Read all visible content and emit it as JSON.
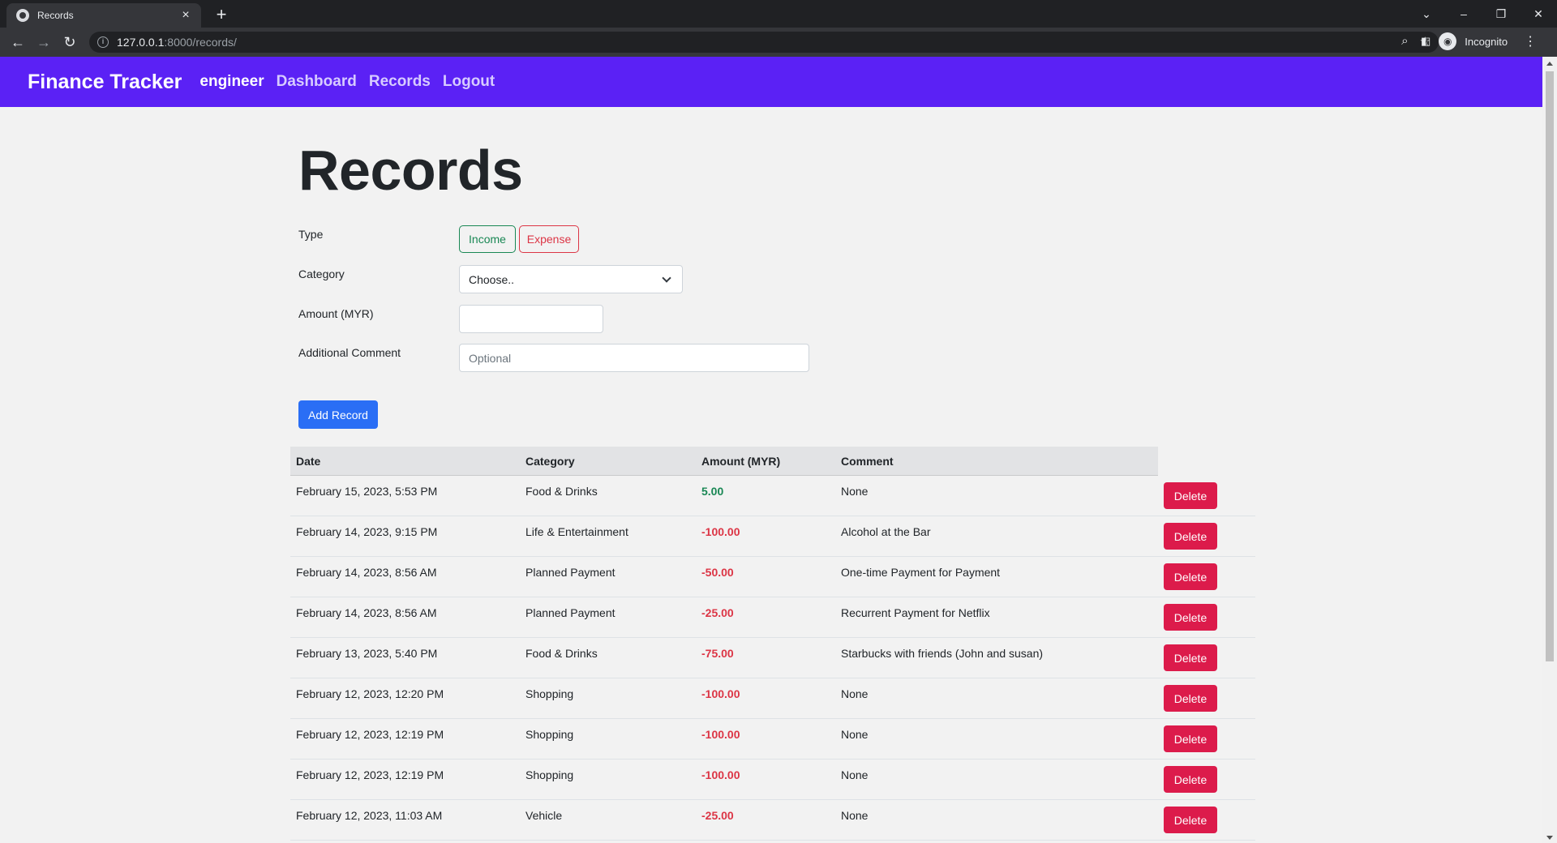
{
  "browser": {
    "tab_title": "Records",
    "url_host": "127.0.0.1",
    "url_rest": ":8000/records/",
    "profile_label": "Incognito"
  },
  "navbar": {
    "brand": "Finance Tracker",
    "user": "engineer",
    "links": [
      "Dashboard",
      "Records",
      "Logout"
    ],
    "bg_color": "#5b21f5"
  },
  "page": {
    "title": "Records"
  },
  "form": {
    "type_label": "Type",
    "income_label": "Income",
    "expense_label": "Expense",
    "category_label": "Category",
    "category_value": "Choose..",
    "amount_label": "Amount (MYR)",
    "amount_value": "",
    "comment_label": "Additional Comment",
    "comment_placeholder": "Optional",
    "submit_label": "Add Record"
  },
  "table": {
    "headers": [
      "Date",
      "Category",
      "Amount (MYR)",
      "Comment"
    ],
    "delete_label": "Delete",
    "rows": [
      {
        "date": "February 15, 2023, 5:53 PM",
        "category": "Food & Drinks",
        "amount": "5.00",
        "type": "income",
        "comment": "None"
      },
      {
        "date": "February 14, 2023, 9:15 PM",
        "category": "Life & Entertainment",
        "amount": "-100.00",
        "type": "expense",
        "comment": "Alcohol at the Bar"
      },
      {
        "date": "February 14, 2023, 8:56 AM",
        "category": "Planned Payment",
        "amount": "-50.00",
        "type": "expense",
        "comment": "One-time Payment for Payment"
      },
      {
        "date": "February 14, 2023, 8:56 AM",
        "category": "Planned Payment",
        "amount": "-25.00",
        "type": "expense",
        "comment": "Recurrent Payment for Netflix"
      },
      {
        "date": "February 13, 2023, 5:40 PM",
        "category": "Food & Drinks",
        "amount": "-75.00",
        "type": "expense",
        "comment": "Starbucks with friends (John and susan)"
      },
      {
        "date": "February 12, 2023, 12:20 PM",
        "category": "Shopping",
        "amount": "-100.00",
        "type": "expense",
        "comment": "None"
      },
      {
        "date": "February 12, 2023, 12:19 PM",
        "category": "Shopping",
        "amount": "-100.00",
        "type": "expense",
        "comment": "None"
      },
      {
        "date": "February 12, 2023, 12:19 PM",
        "category": "Shopping",
        "amount": "-100.00",
        "type": "expense",
        "comment": "None"
      },
      {
        "date": "February 12, 2023, 11:03 AM",
        "category": "Vehicle",
        "amount": "-25.00",
        "type": "expense",
        "comment": "None"
      }
    ]
  }
}
